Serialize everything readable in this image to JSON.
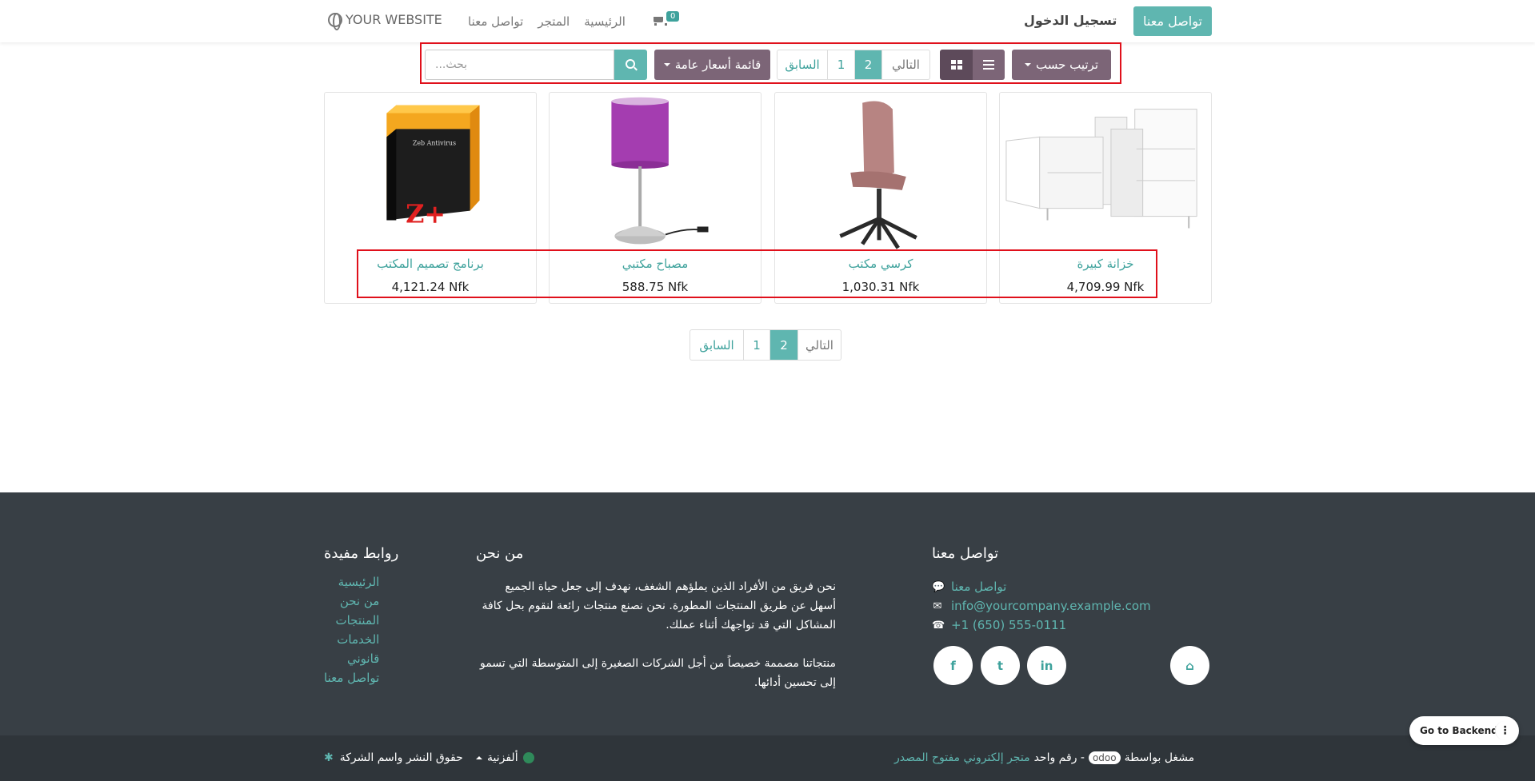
{
  "header": {
    "brand": "YOUR WEBSITE",
    "nav": [
      "الرئيسية",
      "المتجر",
      "تواصل معنا"
    ],
    "cart_count": "0",
    "signin": "تسجيل الدخول",
    "contact_button": "تواصل معنا"
  },
  "toolbar": {
    "search_placeholder": "بحث...",
    "pricelist": "قائمة أسعار عامة",
    "pager": [
      "السابق",
      "1",
      "2",
      "التالي"
    ],
    "active_page": "2",
    "sort": "ترتيب حسب"
  },
  "products": [
    {
      "name": "برنامج تصميم المكتب",
      "price": "4,121.24 Nfk",
      "icon": "software-box-image"
    },
    {
      "name": "مصباح مكتبي",
      "price": "588.75 Nfk",
      "icon": "desk-lamp-image"
    },
    {
      "name": "كرسي مكتب",
      "price": "1,030.31 Nfk",
      "icon": "office-chair-image"
    },
    {
      "name": "خزانة كبيرة",
      "price": "4,709.99 Nfk",
      "icon": "cabinet-image"
    }
  ],
  "box_label": "Zeb Antivirus",
  "pager_bottom": [
    "السابق",
    "1",
    "2",
    "التالي"
  ],
  "footer": {
    "links_title": "روابط مفيدة",
    "links": [
      "الرئيسية",
      "من نحن",
      "المنتجات",
      "الخدمات",
      "قانوني",
      "تواصل معنا"
    ],
    "about_title": "من نحن",
    "about_p1": "نحن فريق من الأفراد الذين يملؤهم الشغف، نهدف إلى جعل حياة الجميع أسهل عن طريق المنتجات المطورة. نحن نصنع منتجات رائعة لنقوم بحل كافة المشاكل التي قد تواجهك أثناء عملك.",
    "about_p2": "منتجاتنا مصممة خصيصاً من أجل الشركات الصغيرة إلى المتوسطة التي تسمو إلى تحسين أدائها.",
    "contact_title": "تواصل معنا",
    "contact_link": "تواصل معنا",
    "email": "info@yourcompany.example.com",
    "phone": "+1 (650) 555-0111",
    "social": [
      "f",
      "t",
      "in"
    ]
  },
  "subfooter": {
    "copyright": "حقوق النشر واسم الشركة",
    "language": "ألفزنية",
    "powered_by": "مشغل بواسطة",
    "odoo": "odoo",
    "dash_text": "- رقم واحد",
    "store_link": "متجر إلكتروني مفتوح المصدر"
  },
  "backend_button": "Go to Backend",
  "colors": {
    "primary": "#5fb6b0",
    "secondary": "#7c6577",
    "footer_bg": "#383f45",
    "highlight": "#e0101b"
  }
}
